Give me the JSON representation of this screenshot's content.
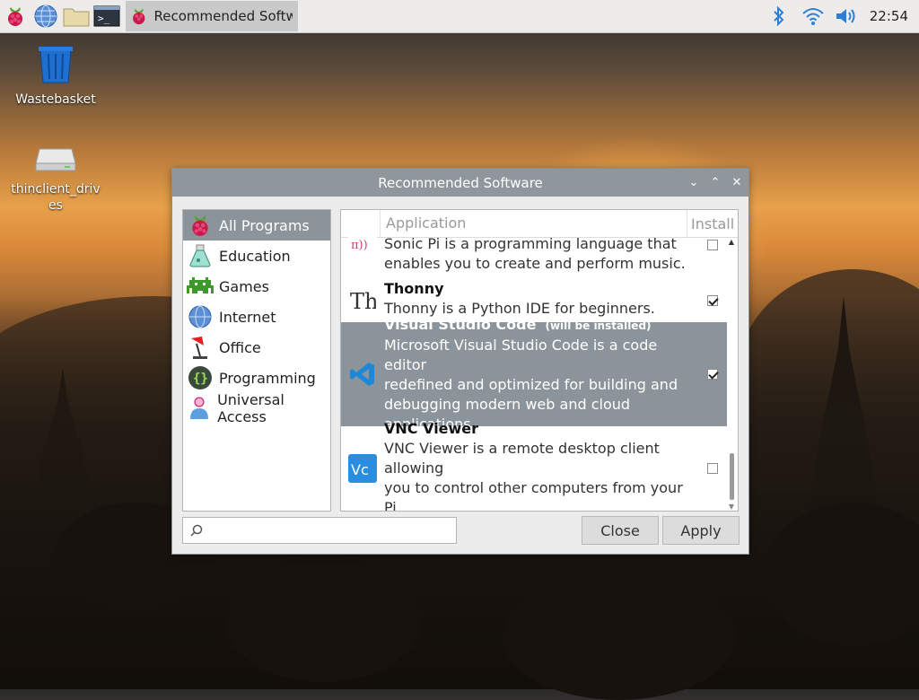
{
  "taskbar": {
    "launchers": [
      "raspberry-menu",
      "web-browser",
      "file-manager",
      "terminal"
    ],
    "task": {
      "title": "Recommended Softw..."
    },
    "tray": {
      "clock": "22:54"
    }
  },
  "desktop": {
    "icons": [
      {
        "label": "Wastebasket"
      },
      {
        "label": "thinclient_drives"
      }
    ]
  },
  "dialog": {
    "title": "Recommended Software",
    "categories": [
      {
        "label": "All Programs",
        "icon": "raspberry-icon",
        "selected": true
      },
      {
        "label": "Education",
        "icon": "flask-icon"
      },
      {
        "label": "Games",
        "icon": "invader-icon"
      },
      {
        "label": "Internet",
        "icon": "globe-icon"
      },
      {
        "label": "Office",
        "icon": "lamp-icon"
      },
      {
        "label": "Programming",
        "icon": "braces-icon"
      },
      {
        "label": "Universal Access",
        "icon": "person-icon"
      }
    ],
    "columns": {
      "application": "Application",
      "install": "Install"
    },
    "apps": [
      {
        "name": "",
        "desc1": "Sonic Pi is a programming language that",
        "desc2": "enables you to create and perform music.",
        "checked": false
      },
      {
        "name": "Thonny",
        "desc1": "Thonny is a Python IDE for beginners.",
        "checked": true
      },
      {
        "name": "Visual Studio Code",
        "tag": "(will be installed)",
        "desc1": "Microsoft Visual Studio Code is a code editor",
        "desc2": "redefined and optimized for building and",
        "desc3": "debugging modern web and cloud applications.",
        "checked": true,
        "selected": true
      },
      {
        "name": "VNC Viewer",
        "desc1": "VNC Viewer is a remote desktop client allowing",
        "desc2": "you to control other computers from your Pi.",
        "checked": false
      }
    ],
    "search_placeholder": "",
    "buttons": {
      "close": "Close",
      "apply": "Apply"
    }
  }
}
